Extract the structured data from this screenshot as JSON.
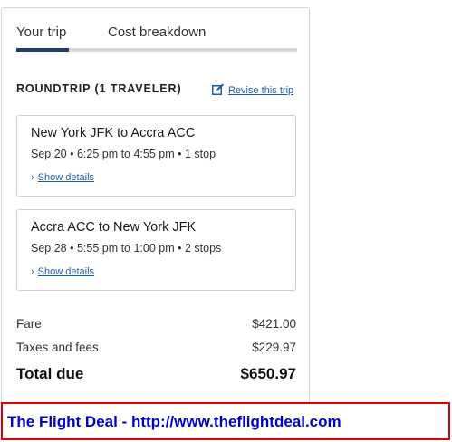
{
  "tabs": [
    {
      "label": "Your trip",
      "active": true
    },
    {
      "label": "Cost breakdown",
      "active": false
    }
  ],
  "trip_summary": {
    "trip_type": "ROUNDTRIP (1 TRAVELER)",
    "revise_label": "Revise this trip",
    "revise_icon": "edit-icon"
  },
  "flights": [
    {
      "route": "New York JFK to Accra ACC",
      "info": "Sep 20 • 6:25 pm to 4:55 pm • 1 stop",
      "details_label": "Show details"
    },
    {
      "route": "Accra ACC to New York JFK",
      "info": "Sep 28 • 5:55 pm to 1:00 pm • 2 stops",
      "details_label": "Show details"
    }
  ],
  "costs": {
    "fare_label": "Fare",
    "fare_value": "$421.00",
    "taxes_label": "Taxes and fees",
    "taxes_value": "$229.97",
    "total_label": "Total due",
    "total_value": "$650.97"
  },
  "banner": {
    "text": "The Flight Deal - http://www.theflightdeal.com"
  },
  "colors": {
    "accent": "#1d3f6e",
    "link": "#1a5fa8",
    "banner_border": "#e00000",
    "banner_text": "#0000cc"
  }
}
